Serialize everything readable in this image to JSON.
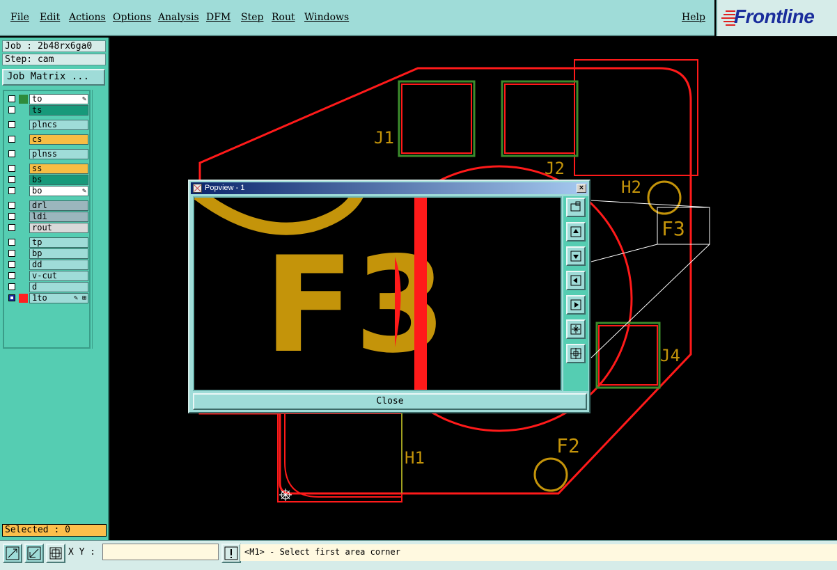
{
  "menu": {
    "items": [
      "File",
      "Edit",
      "Actions",
      "Options",
      "Analysis",
      "DFM",
      "Step",
      "Rout",
      "Windows"
    ],
    "help": "Help"
  },
  "logo": {
    "text": "Frontline"
  },
  "left_panel": {
    "job": "Job : 2b48rx6ga0",
    "step": "Step: cam",
    "job_matrix_button": "Job Matrix ...",
    "layers": [
      {
        "name": "to",
        "name_bg": "#ffffff",
        "swatch": "#2e8b3c",
        "marker": "✎"
      },
      {
        "name": "ts",
        "name_bg": "#17997a",
        "swatch": "",
        "marker": ""
      },
      {
        "name": "plncs",
        "name_bg": "#9fdcd8",
        "swatch": "",
        "marker": ""
      },
      {
        "name": "cs",
        "name_bg": "#f7bd44",
        "swatch": "",
        "marker": ""
      },
      {
        "name": "plnss",
        "name_bg": "#9fdcd8",
        "swatch": "",
        "marker": ""
      },
      {
        "name": "ss",
        "name_bg": "#f7bd44",
        "swatch": "",
        "marker": ""
      },
      {
        "name": "bs",
        "name_bg": "#17997a",
        "swatch": "",
        "marker": ""
      },
      {
        "name": "bo",
        "name_bg": "#ffffff",
        "swatch": "",
        "marker": "✎"
      },
      {
        "name": "drl",
        "name_bg": "#9bb6bd",
        "swatch": "",
        "marker": ""
      },
      {
        "name": "ldi",
        "name_bg": "#9bb6bd",
        "swatch": "",
        "marker": ""
      },
      {
        "name": "rout",
        "name_bg": "#d9d9d9",
        "swatch": "",
        "marker": ""
      },
      {
        "name": "tp",
        "name_bg": "#9fdcd8",
        "swatch": "",
        "marker": ""
      },
      {
        "name": "bp",
        "name_bg": "#9fdcd8",
        "swatch": "",
        "marker": ""
      },
      {
        "name": "dd",
        "name_bg": "#9fdcd8",
        "swatch": "",
        "marker": ""
      },
      {
        "name": "v-cut",
        "name_bg": "#9fdcd8",
        "swatch": "",
        "marker": ""
      },
      {
        "name": "d",
        "name_bg": "#9fdcd8",
        "swatch": "",
        "marker": ""
      },
      {
        "name": "1to",
        "name_bg": "#9fdcd8",
        "swatch": "#ff2020",
        "marker": "✎ ⊞"
      }
    ],
    "selected": "Selected : 0"
  },
  "bottom_bar": {
    "xy_label": "X Y :",
    "xy_value": "",
    "status": "<M1> - Select first area corner"
  },
  "popview": {
    "title": "Popview - 1",
    "close_button": "Close",
    "zoom_label": "F3"
  },
  "board_labels": {
    "j1": "J1",
    "j2": "J2",
    "j4": "J4",
    "h1": "H1",
    "h2": "H2",
    "f2": "F2",
    "f3": "F3"
  },
  "colors": {
    "outline": "#ff1a1a",
    "pad_green": "#3c8c2c",
    "silkscreen": "#c4940a",
    "background": "#000000",
    "panel": "#55cdb2",
    "menu": "#9fdcd8"
  }
}
